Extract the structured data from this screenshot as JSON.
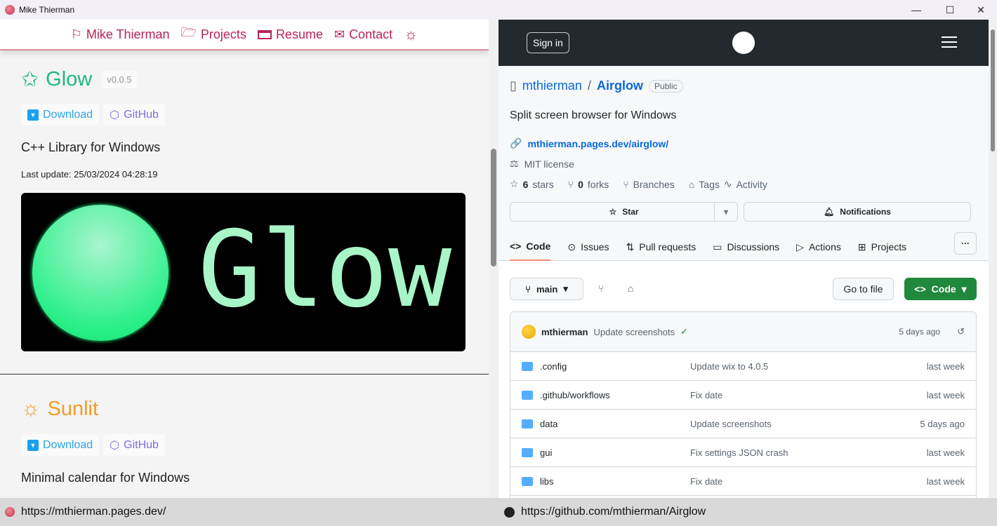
{
  "window": {
    "title": "Mike Thierman",
    "minimize": "—",
    "maximize": "☐",
    "close": "✕"
  },
  "left": {
    "nav": [
      {
        "label": "Mike Thierman",
        "icon": "flag-icon"
      },
      {
        "label": "Projects",
        "icon": "folder-icon"
      },
      {
        "label": "Resume",
        "icon": "resume-icon"
      },
      {
        "label": "Contact",
        "icon": "envelope-icon"
      }
    ],
    "theme_icon": "☼",
    "projects": [
      {
        "name": "Glow",
        "version": "v0.0.5",
        "download": "Download",
        "github": "GitHub",
        "description": "C++ Library for Windows",
        "last_update": "Last update: 25/03/2024 04:28:19",
        "banner_text": "Glow",
        "color": "#20b87c"
      },
      {
        "name": "Sunlit",
        "download": "Download",
        "github": "GitHub",
        "description": "Minimal calendar for Windows",
        "color": "#f39c2a"
      }
    ]
  },
  "right": {
    "sign_in": "Sign in",
    "owner": "mthierman",
    "sep": "/",
    "repo": "Airglow",
    "visibility": "Public",
    "description": "Split screen browser for Windows",
    "website": "mthierman.pages.dev/airglow/",
    "license": "MIT license",
    "stats": {
      "stars_n": "6",
      "stars": "stars",
      "forks_n": "0",
      "forks": "forks",
      "branches": "Branches",
      "tags": "Tags",
      "activity": "Activity"
    },
    "star": "Star",
    "notifications": "Notifications",
    "tabs": [
      "Code",
      "Issues",
      "Pull requests",
      "Discussions",
      "Actions",
      "Projects"
    ],
    "more": "···",
    "branch": "main",
    "go_to_file": "Go to file",
    "code": "Code",
    "commit": {
      "author": "mthierman",
      "message": "Update screenshots",
      "check": "✓",
      "time": "5 days ago"
    },
    "files": [
      {
        "name": ".config",
        "message": "Update wix to 4.0.5",
        "date": "last week"
      },
      {
        "name": ".github/workflows",
        "message": "Fix date",
        "date": "last week"
      },
      {
        "name": "data",
        "message": "Update screenshots",
        "date": "5 days ago"
      },
      {
        "name": "gui",
        "message": "Fix settings JSON crash",
        "date": "last week"
      },
      {
        "name": "libs",
        "message": "Fix date",
        "date": "last week"
      }
    ]
  },
  "status": {
    "left_url": "https://mthierman.pages.dev/",
    "right_url": "https://github.com/mthierman/Airglow"
  }
}
